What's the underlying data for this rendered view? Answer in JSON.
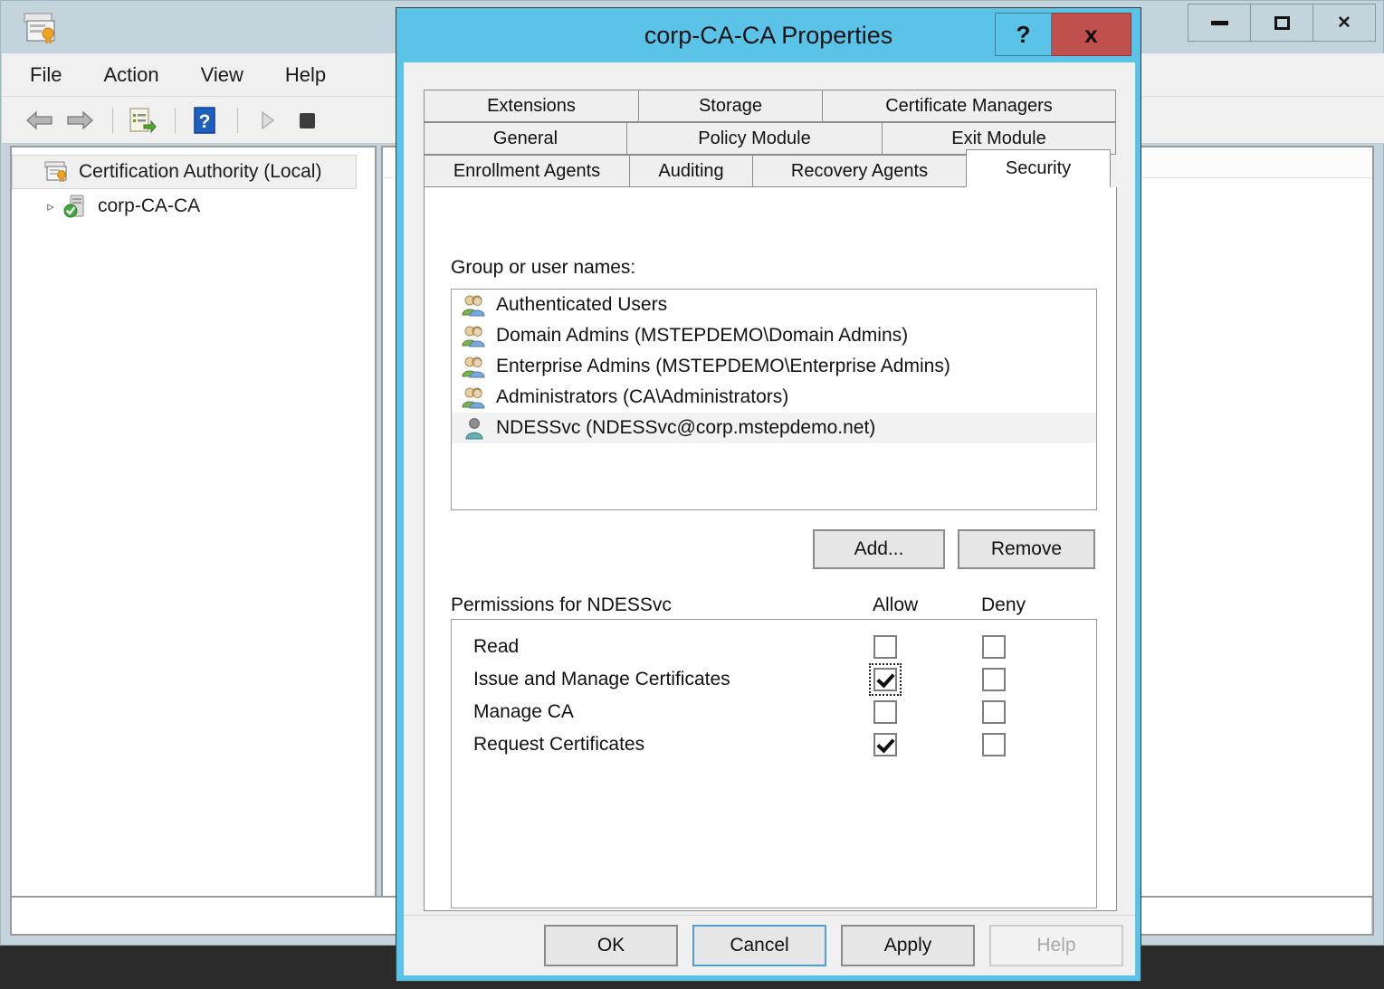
{
  "mmc_window": {
    "app_icon": "certification-authority-icon",
    "menus": [
      "File",
      "Action",
      "View",
      "Help"
    ],
    "toolbar_icons": [
      "back-arrow-icon",
      "forward-arrow-icon",
      "export-list-icon",
      "help-icon",
      "start-service-icon",
      "stop-service-icon"
    ],
    "tree": [
      {
        "label": "Certification Authority (Local)",
        "icon": "certification-authority-icon",
        "selected": true,
        "expander": ""
      },
      {
        "label": "corp-CA-CA",
        "icon": "ca-server-icon",
        "selected": false,
        "expander": "▹"
      }
    ],
    "window_buttons": [
      "minimize",
      "maximize",
      "close"
    ]
  },
  "dialog": {
    "title": "corp-CA-CA Properties",
    "help_button": "?",
    "close_button": "x",
    "tabs": {
      "row1": [
        "Extensions",
        "Storage",
        "Certificate Managers"
      ],
      "row2": [
        "General",
        "Policy Module",
        "Exit Module"
      ],
      "row3": [
        "Enrollment Agents",
        "Auditing",
        "Recovery Agents",
        "Security"
      ],
      "active": "Security"
    },
    "group_label": "Group or user names:",
    "users": [
      {
        "name": "Authenticated Users",
        "icon": "group-icon",
        "selected": false
      },
      {
        "name": "Domain Admins (MSTEPDEMO\\Domain Admins)",
        "icon": "group-icon",
        "selected": false
      },
      {
        "name": "Enterprise Admins (MSTEPDEMO\\Enterprise Admins)",
        "icon": "group-icon",
        "selected": false
      },
      {
        "name": "Administrators (CA\\Administrators)",
        "icon": "group-icon",
        "selected": false
      },
      {
        "name": "NDESSvc (NDESSvc@corp.mstepdemo.net)",
        "icon": "user-icon",
        "selected": true
      }
    ],
    "add_button": "Add...",
    "remove_button": "Remove",
    "permissions_label": "Permissions for NDESSvc",
    "allow_header": "Allow",
    "deny_header": "Deny",
    "permissions": [
      {
        "label": "Read",
        "allow": false,
        "deny": false,
        "focused": false
      },
      {
        "label": "Issue and Manage Certificates",
        "allow": true,
        "deny": false,
        "focused": true
      },
      {
        "label": "Manage CA",
        "allow": false,
        "deny": false,
        "focused": false
      },
      {
        "label": "Request Certificates",
        "allow": true,
        "deny": false,
        "focused": false
      }
    ],
    "footer_buttons": [
      {
        "label": "OK",
        "state": "normal"
      },
      {
        "label": "Cancel",
        "state": "focus"
      },
      {
        "label": "Apply",
        "state": "normal"
      },
      {
        "label": "Help",
        "state": "disabled"
      }
    ]
  },
  "colors": {
    "dialog_border": "#5bc3e8",
    "close_button": "#c0504d",
    "mmc_chrome": "#c3d4dd",
    "focus_blue": "#4d9fd4"
  }
}
